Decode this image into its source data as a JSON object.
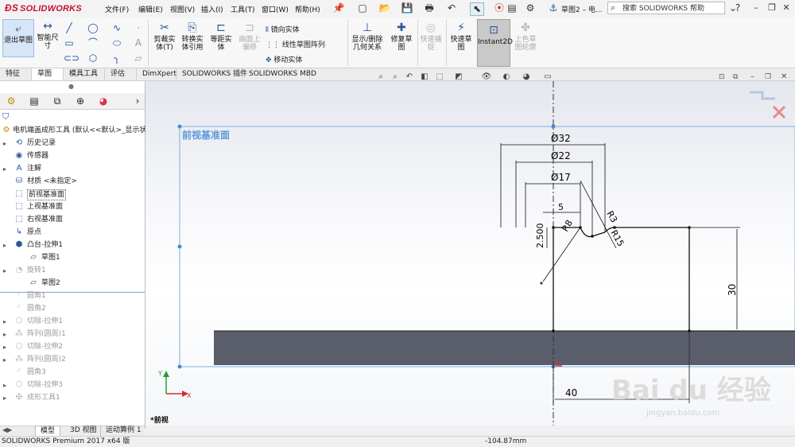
{
  "app": {
    "logo_text": "SOLIDWORKS",
    "document_title": "草图2 – 电..."
  },
  "menu": [
    "文件(F)",
    "编辑(E)",
    "视图(V)",
    "插入(I)",
    "工具(T)",
    "窗口(W)",
    "帮助(H)"
  ],
  "search": {
    "placeholder": "搜索 SOLIDWORKS 帮助"
  },
  "ribbon": {
    "exit_sketch": "退出草图",
    "smart_dim": "智能尺寸",
    "trim": "剪裁实体(T)",
    "convert": "转换实体引用",
    "offset": "等距实体",
    "surface_offset": "曲面上偏移",
    "mirror": "镜向实体",
    "linear_pattern": "线性草图阵列",
    "move": "移动实体",
    "display_delete": "显示/删除几何关系",
    "repair": "修复草图",
    "quick_snap": "快速捕捉",
    "rapid_sketch": "快速草图",
    "instant2d": "Instant2D",
    "shaded_sketch": "上色草图轮廓"
  },
  "tabs": [
    "特征",
    "草图",
    "模具工具",
    "评估",
    "DimXpert",
    "SOLIDWORKS 插件",
    "SOLIDWORKS MBD"
  ],
  "tree": {
    "root": "电机端盖成形工具 (默认<<默认>_显示状",
    "items": [
      {
        "label": "历史记录",
        "icon": "history-icon",
        "state": "normal",
        "expand": true
      },
      {
        "label": "传感器",
        "icon": "sensor-icon",
        "state": "normal",
        "expand": false
      },
      {
        "label": "注解",
        "icon": "annotation-icon",
        "state": "normal",
        "expand": true
      },
      {
        "label": "材质 <未指定>",
        "icon": "material-icon",
        "state": "normal",
        "expand": false
      },
      {
        "label": "前视基准面",
        "icon": "plane-icon",
        "state": "selected",
        "expand": false
      },
      {
        "label": "上视基准面",
        "icon": "plane-icon",
        "state": "normal",
        "expand": false
      },
      {
        "label": "右视基准面",
        "icon": "plane-icon",
        "state": "normal",
        "expand": false
      },
      {
        "label": "原点",
        "icon": "origin-icon",
        "state": "normal",
        "expand": false
      },
      {
        "label": "凸台-拉伸1",
        "icon": "boss-extrude-icon",
        "state": "normal",
        "expand": true
      },
      {
        "label": "草图1",
        "icon": "sketch-icon",
        "state": "child",
        "expand": false
      },
      {
        "label": "旋转1",
        "icon": "revolve-icon",
        "state": "gray",
        "expand": true
      },
      {
        "label": "草图2",
        "icon": "sketch-icon",
        "state": "child",
        "expand": false
      },
      {
        "label": "圆角1",
        "icon": "fillet-icon",
        "state": "gray",
        "expand": false
      },
      {
        "label": "圆角2",
        "icon": "fillet-icon",
        "state": "gray",
        "expand": false
      },
      {
        "label": "切除-拉伸1",
        "icon": "cut-extrude-icon",
        "state": "gray",
        "expand": true
      },
      {
        "label": "阵列(圆周)1",
        "icon": "circular-pattern-icon",
        "state": "gray",
        "expand": true
      },
      {
        "label": "切除-拉伸2",
        "icon": "cut-extrude-icon",
        "state": "gray",
        "expand": true
      },
      {
        "label": "阵列(圆周)2",
        "icon": "circular-pattern-icon",
        "state": "gray",
        "expand": true
      },
      {
        "label": "圆角3",
        "icon": "fillet-icon",
        "state": "gray",
        "expand": false
      },
      {
        "label": "切除-拉伸3",
        "icon": "cut-extrude-icon",
        "state": "gray",
        "expand": true
      },
      {
        "label": "成形工具1",
        "icon": "forming-tool-icon",
        "state": "gray",
        "expand": true
      }
    ]
  },
  "bottom_tabs": [
    "模型",
    "3D 视图",
    "运动算例 1"
  ],
  "graphics": {
    "plane_label": "前视基准面",
    "view_label": "*前视",
    "dims": {
      "d32": "Ø32",
      "d22": "Ø22",
      "d17": "Ø17",
      "w5": "5",
      "h2500": "2.500",
      "r8": "R8",
      "r3": "R3",
      "r15": "R15",
      "h30": "30",
      "w40": "40"
    },
    "watermark": "Bai du 经验",
    "watermark_url": "jingyan.baidu.com"
  },
  "status": {
    "product": "SOLIDWORKS Premium 2017 x64 版",
    "coord": "-104.87mm"
  },
  "colors": {
    "brand": "#c8102e",
    "plane": "#5a9ad8",
    "body": "#5a5d6a"
  }
}
